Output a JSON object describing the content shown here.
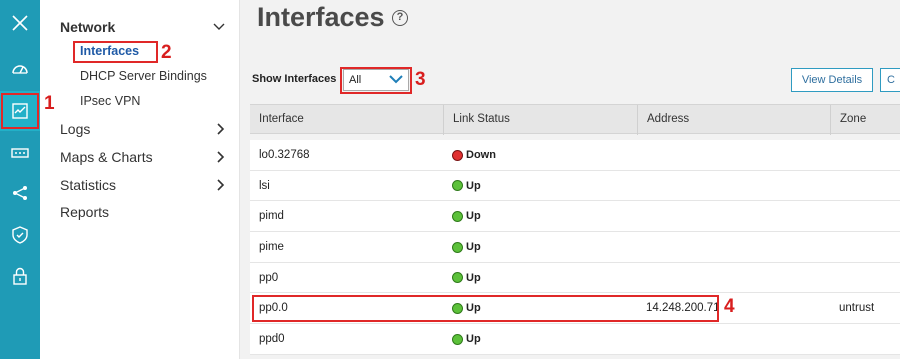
{
  "rail": {
    "items": [
      {
        "name": "close-icon"
      },
      {
        "name": "dashboard-icon"
      },
      {
        "name": "monitor-icon"
      },
      {
        "name": "device-icon"
      },
      {
        "name": "network-share-icon"
      },
      {
        "name": "security-shield-icon"
      },
      {
        "name": "lock-icon"
      }
    ]
  },
  "nav": {
    "network": "Network",
    "interfaces": "Interfaces",
    "dhcp": "DHCP Server Bindings",
    "ipsec": "IPsec VPN",
    "logs": "Logs",
    "maps": "Maps & Charts",
    "statistics": "Statistics",
    "reports": "Reports"
  },
  "page": {
    "title": "Interfaces",
    "help": "?"
  },
  "filter": {
    "label": "Show Interfaces",
    "value": "All"
  },
  "buttons": {
    "view_details": "View Details",
    "next": "C"
  },
  "table": {
    "headers": [
      "Interface",
      "Link Status",
      "Address",
      "Zone"
    ],
    "rows": [
      {
        "interface": "lo0.32768",
        "status": "Down",
        "address": "",
        "zone": ""
      },
      {
        "interface": "lsi",
        "status": "Up",
        "address": "",
        "zone": ""
      },
      {
        "interface": "pimd",
        "status": "Up",
        "address": "",
        "zone": ""
      },
      {
        "interface": "pime",
        "status": "Up",
        "address": "",
        "zone": ""
      },
      {
        "interface": "pp0",
        "status": "Up",
        "address": "",
        "zone": ""
      },
      {
        "interface": "pp0.0",
        "status": "Up",
        "address": "14.248.200.71",
        "zone": "untrust"
      },
      {
        "interface": "ppd0",
        "status": "Up",
        "address": "",
        "zone": ""
      }
    ]
  },
  "annotations": [
    "1",
    "2",
    "3",
    "4"
  ],
  "colors": {
    "rail": "#1f9bb6",
    "accent": "#2f9bc1",
    "annotation": "#e02828",
    "up": "#5cc13a",
    "down": "#e03030"
  }
}
